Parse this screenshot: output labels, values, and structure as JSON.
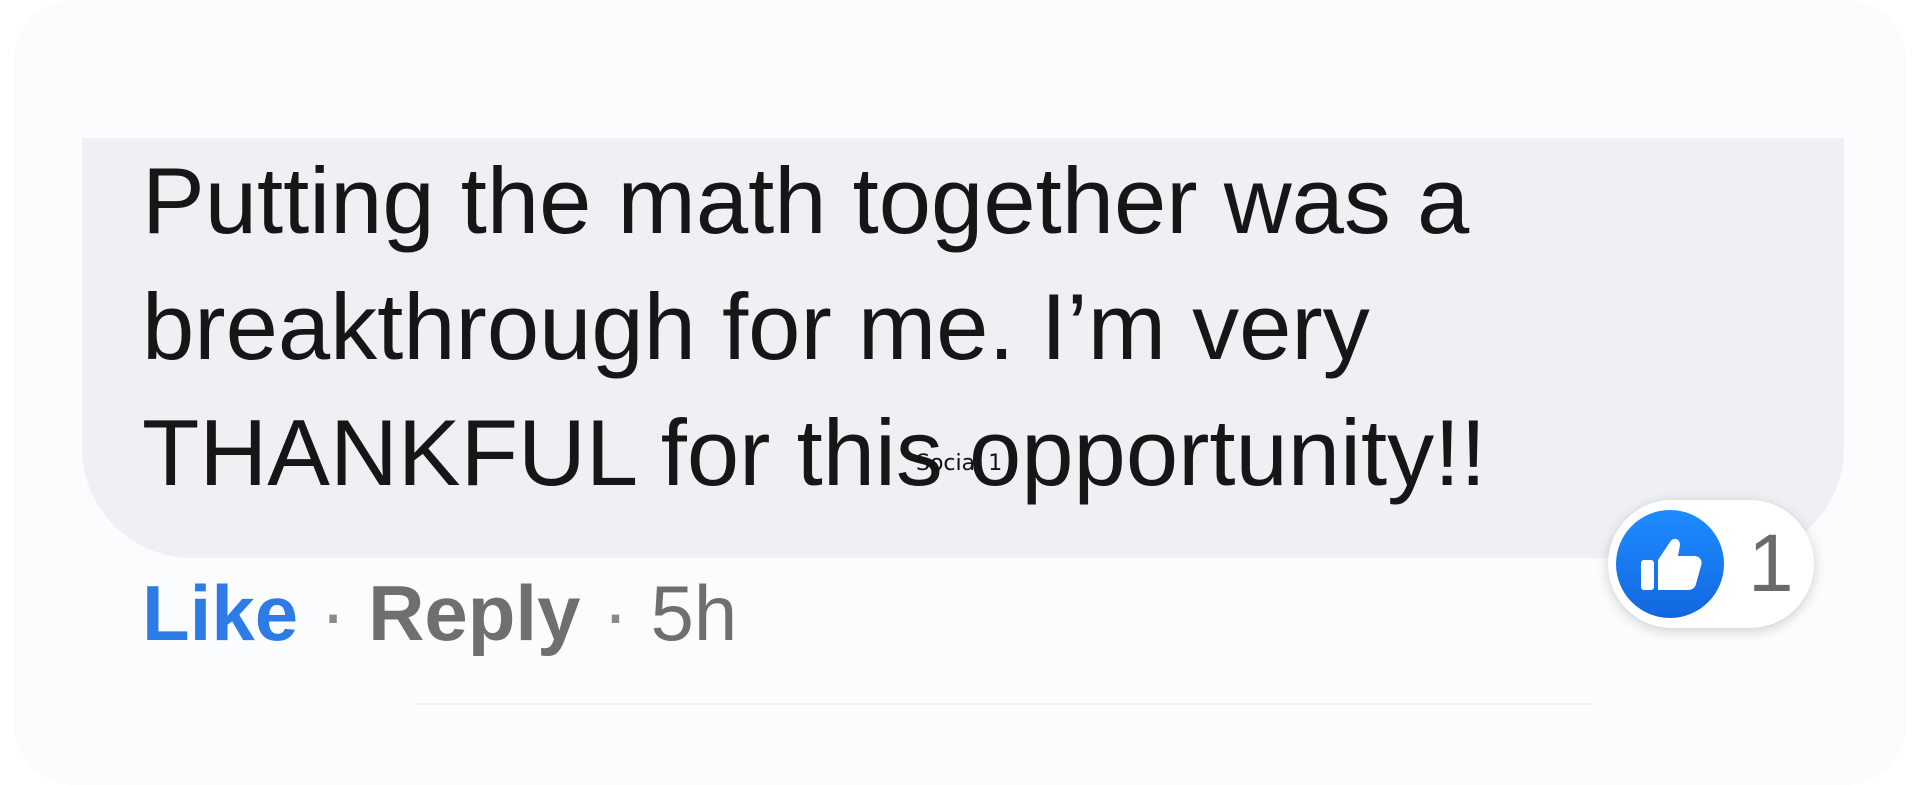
{
  "comment": {
    "lines": [
      "Putting the math together was a",
      "breakthrough for me. I’m very",
      "THANKFUL for this opportunity!!"
    ]
  },
  "overlay_caption": "Social 1",
  "actions": {
    "like_label": "Like",
    "separator": "·",
    "reply_label": "Reply",
    "timestamp": "5h"
  },
  "reaction": {
    "icon": "thumbs-up-icon",
    "count": "1"
  },
  "colors": {
    "like_blue": "#2d7be6",
    "bubble_bg": "#eef0f3",
    "muted_text": "#6f6f6f",
    "reaction_icon_blue": "#1877f2"
  }
}
